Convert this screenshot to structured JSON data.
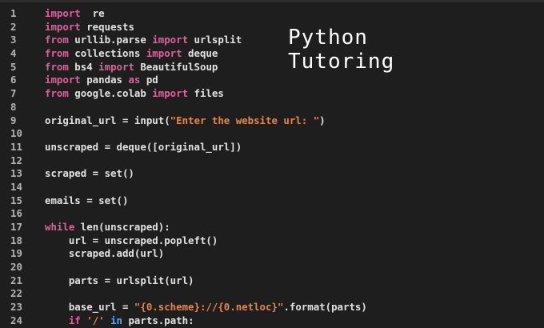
{
  "overlay_title": [
    "Python",
    "Tutoring"
  ],
  "colors": {
    "background": "#1e1e1e",
    "keyword": "#e0609c",
    "keyword_in": "#5aa8ee",
    "string": "#e8844e",
    "text": "#e2e2e2",
    "line_number": "#b4b4b4"
  },
  "lines": [
    {
      "num": "1",
      "tokens": [
        [
          "kw",
          "import"
        ],
        [
          "",
          "  re"
        ]
      ]
    },
    {
      "num": "2",
      "tokens": [
        [
          "kw",
          "import"
        ],
        [
          "",
          " requests"
        ]
      ]
    },
    {
      "num": "3",
      "tokens": [
        [
          "kw",
          "from"
        ],
        [
          "",
          " urllib.parse "
        ],
        [
          "kw",
          "import"
        ],
        [
          "",
          " urlsplit"
        ]
      ]
    },
    {
      "num": "4",
      "tokens": [
        [
          "kw",
          "from"
        ],
        [
          "",
          " collections "
        ],
        [
          "kw",
          "import"
        ],
        [
          "",
          " deque"
        ]
      ]
    },
    {
      "num": "5",
      "tokens": [
        [
          "kw",
          "from"
        ],
        [
          "",
          " bs4 "
        ],
        [
          "kw",
          "import"
        ],
        [
          "",
          " BeautifulSoup"
        ]
      ]
    },
    {
      "num": "6",
      "tokens": [
        [
          "kw",
          "import"
        ],
        [
          "",
          " pandas "
        ],
        [
          "kw",
          "as"
        ],
        [
          "",
          " pd"
        ]
      ]
    },
    {
      "num": "7",
      "tokens": [
        [
          "kw",
          "from"
        ],
        [
          "",
          " google.colab "
        ],
        [
          "kw",
          "import"
        ],
        [
          "",
          " files"
        ]
      ]
    },
    {
      "num": "8",
      "tokens": []
    },
    {
      "num": "9",
      "tokens": [
        [
          "",
          "original_url = input("
        ],
        [
          "str",
          "\"Enter the website url: \""
        ],
        [
          "",
          ")"
        ]
      ]
    },
    {
      "num": "10",
      "tokens": []
    },
    {
      "num": "11",
      "tokens": [
        [
          "",
          "unscraped = deque([original_url])"
        ]
      ]
    },
    {
      "num": "12",
      "tokens": []
    },
    {
      "num": "13",
      "tokens": [
        [
          "",
          "scraped = set()"
        ]
      ]
    },
    {
      "num": "14",
      "tokens": []
    },
    {
      "num": "15",
      "tokens": [
        [
          "",
          "emails = set()"
        ]
      ]
    },
    {
      "num": "16",
      "tokens": []
    },
    {
      "num": "17",
      "tokens": [
        [
          "kw",
          "while"
        ],
        [
          "",
          " len(unscraped):"
        ]
      ]
    },
    {
      "num": "18",
      "tokens": [
        [
          "",
          "    url = unscraped.popleft()"
        ]
      ]
    },
    {
      "num": "19",
      "tokens": [
        [
          "",
          "    scraped.add(url)"
        ]
      ]
    },
    {
      "num": "20",
      "tokens": []
    },
    {
      "num": "21",
      "tokens": [
        [
          "",
          "    parts = urlsplit(url)"
        ]
      ]
    },
    {
      "num": "22",
      "tokens": []
    },
    {
      "num": "23",
      "tokens": [
        [
          "",
          "    base_url = "
        ],
        [
          "str",
          "\"{0.scheme}://{0.netloc}\""
        ],
        [
          "",
          ".format(parts)"
        ]
      ]
    },
    {
      "num": "24",
      "tokens": [
        [
          "",
          "    "
        ],
        [
          "kw",
          "if"
        ],
        [
          "",
          " "
        ],
        [
          "str",
          "'/'"
        ],
        [
          "",
          " "
        ],
        [
          "kw2",
          "in"
        ],
        [
          "",
          " parts.path:"
        ]
      ]
    }
  ]
}
